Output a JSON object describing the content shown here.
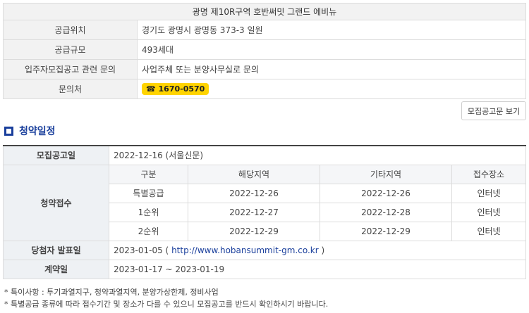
{
  "info": {
    "title": "광명 제10R구역 호반써밋 그랜드 에비뉴",
    "rows": [
      {
        "label": "공급위치",
        "value": "경기도 광명시 광명동 373-3 일원"
      },
      {
        "label": "공급규모",
        "value": "493세대"
      },
      {
        "label": "입주자모집공고 관련 문의",
        "value": "사업주체 또는 분양사무실로 문의"
      }
    ],
    "contact_label": "문의처",
    "phone": "☎ 1670-0570"
  },
  "notice_button": "모집공고문 보기",
  "section": {
    "title": "청약일정"
  },
  "schedule": {
    "announce_label": "모집공고일",
    "announce_value": "2022-12-16 (서울신문)",
    "apply_label": "청약접수",
    "headers": [
      "구분",
      "해당지역",
      "기타지역",
      "접수장소"
    ],
    "rows": [
      [
        "특별공급",
        "2022-12-26",
        "2022-12-26",
        "인터넷"
      ],
      [
        "1순위",
        "2022-12-27",
        "2022-12-28",
        "인터넷"
      ],
      [
        "2순위",
        "2022-12-29",
        "2022-12-29",
        "인터넷"
      ]
    ],
    "winner_label": "당첨자 발표일",
    "winner_date": "2023-01-05 (",
    "winner_link": "http://www.hobansummit-gm.co.kr",
    "winner_close": ")",
    "contract_label": "계약일",
    "contract_value": "2023-01-17 ~ 2023-01-19"
  },
  "notes": [
    "* 특이사항 : 투기과열지구, 청약과열지역, 분양가상한제, 정비사업",
    "* 특별공급 종류에 따라 접수기간 및 장소가 다를 수 있으니 모집공고를 반드시 확인하시기 바랍니다."
  ],
  "colors": {
    "accent": "#1a3f9c",
    "phone_badge": "#ffd400"
  }
}
